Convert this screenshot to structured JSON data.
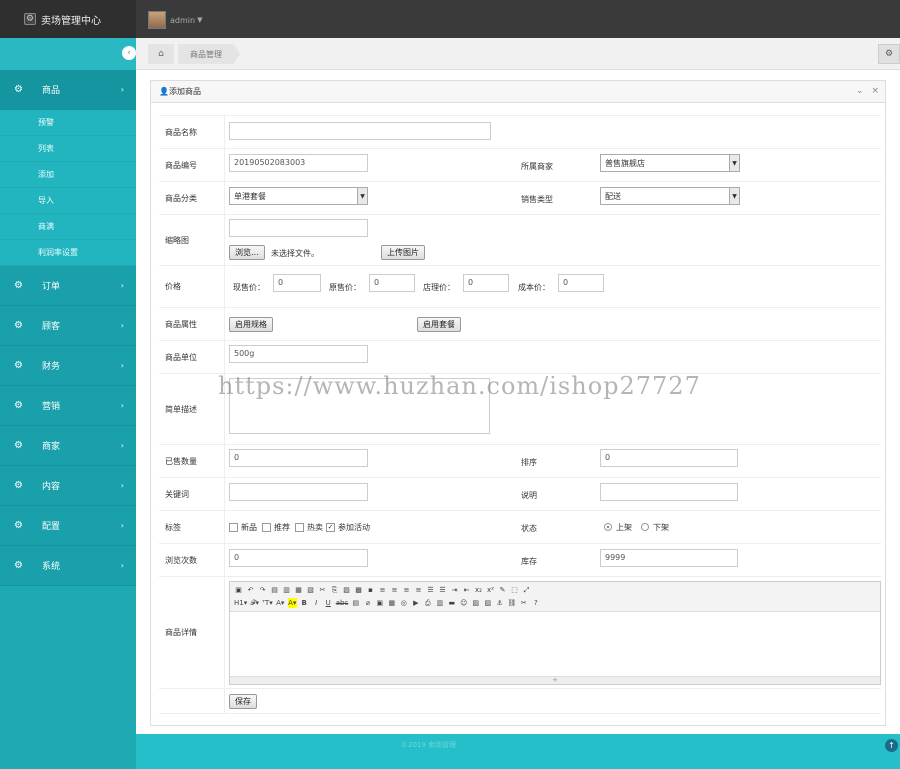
{
  "app": {
    "title": "卖场管理中心"
  },
  "user": {
    "name": "admin"
  },
  "sidebar": {
    "items": [
      {
        "label": "商品",
        "open": true,
        "sub": [
          "预警",
          "列表",
          "添加",
          "导入",
          "商满",
          "利润率设置"
        ]
      },
      {
        "label": "订单"
      },
      {
        "label": "顾客"
      },
      {
        "label": "财务"
      },
      {
        "label": "营销"
      },
      {
        "label": "商家"
      },
      {
        "label": "内容"
      },
      {
        "label": "配置"
      },
      {
        "label": "系统"
      }
    ]
  },
  "breadcrumb": {
    "item": "商品管理"
  },
  "panel": {
    "title": "添加商品"
  },
  "form": {
    "name_label": "商品名称",
    "name_value": "",
    "code_label": "商品编号",
    "code_value": "20190502083003",
    "shop_label": "所属商家",
    "shop_value": "普售旗舰店",
    "category_label": "商品分类",
    "category_value": "单港套餐",
    "sale_type_label": "销售类型",
    "sale_type_value": "配送",
    "thumb_label": "缩略图",
    "browse_label": "浏览...",
    "no_file_text": "未选择文件。",
    "upload_label": "上传图片",
    "price_label": "价格",
    "price_current_label": "现售价：",
    "price_current": "0",
    "price_original_label": "原售价：",
    "price_original": "0",
    "price_store_label": "店理价：",
    "price_store": "0",
    "price_cost_label": "成本价：",
    "price_cost": "0",
    "attr_label": "商品属性",
    "enable_spec_label": "启用规格",
    "enable_package_label": "启用套餐",
    "unit_label": "商品单位",
    "unit_value": "500g",
    "desc_label": "简单描述",
    "sold_label": "已售数量",
    "sold_value": "0",
    "sort_label": "排序",
    "sort_value": "0",
    "keyword_label": "关键词",
    "note_label": "说明",
    "tag_label": "标签",
    "tag_new": "新品",
    "tag_recommend": "推荐",
    "tag_hot": "热卖",
    "tag_activity": "参加活动",
    "status_label": "状态",
    "status_on": "上架",
    "status_off": "下架",
    "views_label": "浏览次数",
    "views_value": "0",
    "stock_label": "库存",
    "stock_value": "9999",
    "detail_label": "商品详情",
    "save_label": "保存"
  },
  "watermark": "https://www.huzhan.com/ishop27727",
  "footer": {
    "copyright": "©2019 卖场管理"
  },
  "colors": {
    "sidebar": "#1fa9b3",
    "topbar": "#3a3a3a",
    "background": "#24bfc8"
  }
}
